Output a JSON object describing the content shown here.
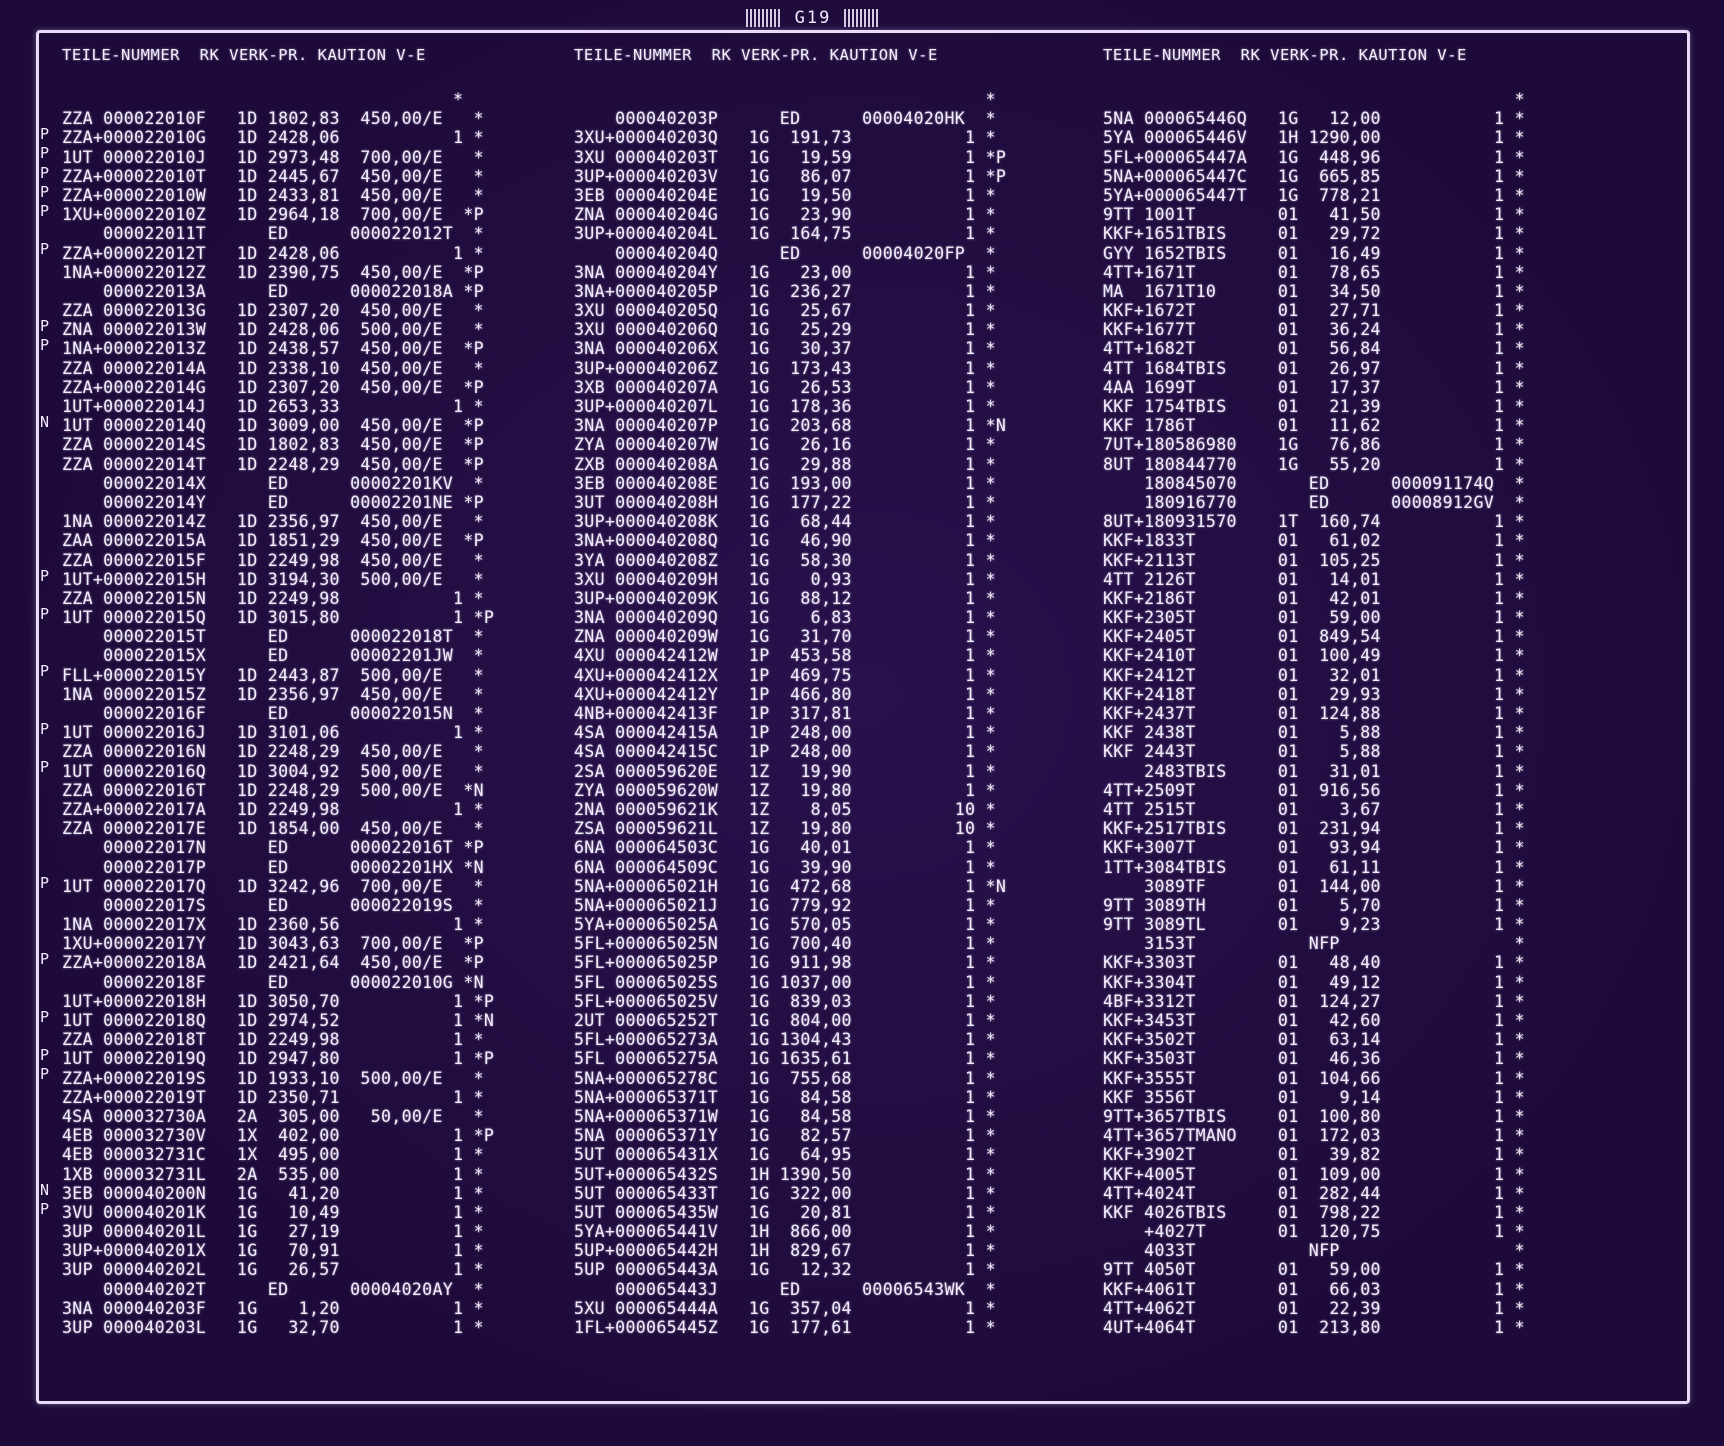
{
  "sheet": {
    "code": "G19"
  },
  "columns": {
    "header": "TEILE-NUMMER  RK VERK-PR. KAUTION V-E"
  },
  "panel1": [
    "                                      *",
    "ZZA 000022010F   1D 1802,83  450,00/E   *",
    "ZZA+000022010G   1D 2428,06           1 *",
    "1UT 000022010J   1D 2973,48  700,00/E   *",
    "ZZA+000022010T   1D 2445,67  450,00/E   *",
    "ZZA+000022010W   1D 2433,81  450,00/E   *",
    "1XU+000022010Z   1D 2964,18  700,00/E  *P",
    "    000022011T      ED      000022012T  *",
    "ZZA+000022012T   1D 2428,06           1 *",
    "1NA+000022012Z   1D 2390,75  450,00/E  *P",
    "    000022013A      ED      000022018A *P",
    "ZZA 000022013G   1D 2307,20  450,00/E   *",
    "ZNA 000022013W   1D 2428,06  500,00/E   *",
    "1NA+000022013Z   1D 2438,57  450,00/E  *P",
    "ZZA 000022014A   1D 2338,10  450,00/E   *",
    "ZZA+000022014G   1D 2307,20  450,00/E  *P",
    "1UT+000022014J   1D 2653,33           1 *",
    "1UT 000022014Q   1D 3009,00  450,00/E  *P",
    "ZZA 000022014S   1D 1802,83  450,00/E  *P",
    "ZZA 000022014T   1D 2248,29  450,00/E  *P",
    "    000022014X      ED      00002201KV  *",
    "    000022014Y      ED      00002201NE *P",
    "1NA 000022014Z   1D 2356,97  450,00/E   *",
    "ZAA 000022015A   1D 1851,29  450,00/E  *P",
    "ZZA 000022015F   1D 2249,98  450,00/E   *",
    "1UT+000022015H   1D 3194,30  500,00/E   *",
    "ZZA 000022015N   1D 2249,98           1 *",
    "1UT 000022015Q   1D 3015,80           1 *P",
    "    000022015T      ED      000022018T  *",
    "    000022015X      ED      00002201JW  *",
    "FLL+000022015Y   1D 2443,87  500,00/E   *",
    "1NA 000022015Z   1D 2356,97  450,00/E   *",
    "    000022016F      ED      000022015N  *",
    "1UT 000022016J   1D 3101,06           1 *",
    "ZZA 000022016N   1D 2248,29  450,00/E   *",
    "1UT 000022016Q   1D 3004,92  500,00/E   *",
    "ZZA 000022016T   1D 2248,29  500,00/E  *N",
    "ZZA+000022017A   1D 2249,98           1 *",
    "ZZA 000022017E   1D 1854,00  450,00/E   *",
    "    000022017N      ED      000022016T *P",
    "    000022017P      ED      00002201HX *N",
    "1UT 000022017Q   1D 3242,96  700,00/E   *",
    "    000022017S      ED      000022019S  *",
    "1NA 000022017X   1D 2360,56           1 *",
    "1XU+000022017Y   1D 3043,63  700,00/E  *P",
    "ZZA+000022018A   1D 2421,64  450,00/E  *P",
    "    000022018F      ED      000022010G *N",
    "1UT+000022018H   1D 3050,70           1 *P",
    "1UT 000022018Q   1D 2974,52           1 *N",
    "ZZA 000022018T   1D 2249,98           1 *",
    "1UT 000022019Q   1D 2947,80           1 *P",
    "ZZA+000022019S   1D 1933,10  500,00/E   *",
    "ZZA+000022019T   1D 2350,71           1 *",
    "4SA 000032730A   2A  305,00   50,00/E   *",
    "4EB 000032730V   1X  402,00           1 *P",
    "4EB 000032731C   1X  495,00           1 *",
    "1XB 000032731L   2A  535,00           1 *",
    "3EB 000040200N   1G   41,20           1 *",
    "3VU 000040201K   1G   10,49           1 *",
    "3UP 000040201L   1G   27,19           1 *",
    "3UP+000040201X   1G   70,91           1 *",
    "3UP 000040202L   1G   26,57           1 *",
    "    000040202T      ED      00004020AY  *",
    "3NA 000040203F   1G    1,20           1 *",
    "3UP 000040203L   1G   32,70           1 *"
  ],
  "panel2": [
    "                                        *",
    "    000040203P      ED      00004020HK  *",
    "3XU+000040203Q   1G  191,73           1 *",
    "3XU 000040203T   1G   19,59           1 *P",
    "3UP+000040203V   1G   86,07           1 *P",
    "3EB 000040204E   1G   19,50           1 *",
    "ZNA 000040204G   1G   23,90           1 *",
    "3UP+000040204L   1G  164,75           1 *",
    "    000040204Q      ED      00004020FP  *",
    "3NA 000040204Y   1G   23,00           1 *",
    "3NA+000040205P   1G  236,27           1 *",
    "3XU 000040205Q   1G   25,67           1 *",
    "3XU 000040206Q   1G   25,29           1 *",
    "3NA 000040206X   1G   30,37           1 *",
    "3UP+000040206Z   1G  173,43           1 *",
    "3XB 000040207A   1G   26,53           1 *",
    "3UP+000040207L   1G  178,36           1 *",
    "3NA 000040207P   1G  203,68           1 *N",
    "ZYA 000040207W   1G   26,16           1 *",
    "ZXB 000040208A   1G   29,88           1 *",
    "3EB 000040208E   1G  193,00           1 *",
    "3UT 000040208H   1G  177,22           1 *",
    "3UP+000040208K   1G   68,44           1 *",
    "3NA+000040208Q   1G   46,90           1 *",
    "3YA 000040208Z   1G   58,30           1 *",
    "3XU 000040209H   1G    0,93           1 *",
    "3UP+000040209K   1G   88,12           1 *",
    "3NA 000040209Q   1G    6,83           1 *",
    "ZNA 000040209W   1G   31,70           1 *",
    "4XU 000042412W   1P  453,58           1 *",
    "4XU+000042412X   1P  469,75           1 *",
    "4XU+000042412Y   1P  466,80           1 *",
    "4NB+000042413F   1P  317,81           1 *",
    "4SA 000042415A   1P  248,00           1 *",
    "4SA 000042415C   1P  248,00           1 *",
    "2SA 000059620E   1Z   19,90           1 *",
    "ZYA 000059620W   1Z   19,80           1 *",
    "2NA 000059621K   1Z    8,05          10 *",
    "ZSA 000059621L   1Z   19,80          10 *",
    "6NA 000064503C   1G   40,01           1 *",
    "6NA 000064509C   1G   39,90           1 *",
    "5NA+000065021H   1G  472,68           1 *N",
    "5NA+000065021J   1G  779,92           1 *",
    "5YA+000065025A   1G  570,05           1 *",
    "5FL+000065025N   1G  700,40           1 *",
    "5FL+000065025P   1G  911,98           1 *",
    "5FL 000065025S   1G 1037,00           1 *",
    "5FL+000065025V   1G  839,03           1 *",
    "2UT 000065252T   1G  804,00           1 *",
    "5FL+000065273A   1G 1304,43           1 *",
    "5FL 000065275A   1G 1635,61           1 *",
    "5NA+000065278C   1G  755,68           1 *",
    "5NA+000065371T   1G   84,58           1 *",
    "5NA+000065371W   1G   84,58           1 *",
    "5NA 000065371Y   1G   82,57           1 *",
    "5UT 000065431X   1G   64,95           1 *",
    "5UT+000065432S   1H 1390,50           1 *",
    "5UT 000065433T   1G  322,00           1 *",
    "5UT 000065435W   1G   20,81           1 *",
    "5YA+000065441V   1H  866,00           1 *",
    "5UP+000065442H   1H  829,67           1 *",
    "5UP 000065443A   1G   12,32           1 *",
    "    000065443J      ED      00006543WK  *",
    "5XU 000065444A   1G  357,04           1 *",
    "1FL+000065445Z   1G  177,61           1 *"
  ],
  "panel3": [
    "                                        *",
    "5NA 000065446Q   1G   12,00           1 *",
    "5YA 000065446V   1H 1290,00           1 *",
    "5FL+000065447A   1G  448,96           1 *",
    "5NA+000065447C   1G  665,85           1 *",
    "5YA+000065447T   1G  778,21           1 *",
    "9TT 1001T        01   41,50           1 *",
    "KKF+1651TBIS     01   29,72           1 *",
    "GYY 1652TBIS     01   16,49           1 *",
    "4TT+1671T        01   78,65           1 *",
    "MA  1671T10      01   34,50           1 *",
    "KKF+1672T        01   27,71           1 *",
    "KKF+1677T        01   36,24           1 *",
    "4TT+1682T        01   56,84           1 *",
    "4TT 1684TBIS     01   26,97           1 *",
    "4AA 1699T        01   17,37           1 *",
    "KKF 1754TBIS     01   21,39           1 *",
    "KKF 1786T        01   11,62           1 *",
    "7UT+180586980    1G   76,86           1 *",
    "8UT 180844770    1G   55,20           1 *",
    "    180845070       ED      000091174Q  *",
    "    180916770       ED      00008912GV  *",
    "8UT+180931570    1T  160,74           1 *",
    "KKF+1833T        01   61,02           1 *",
    "KKF+2113T        01  105,25           1 *",
    "4TT 2126T        01   14,01           1 *",
    "KKF+2186T        01   42,01           1 *",
    "KKF+2305T        01   59,00           1 *",
    "KKF+2405T        01  849,54           1 *",
    "KKF+2410T        01  100,49           1 *",
    "KKF+2412T        01   32,01           1 *",
    "KKF+2418T        01   29,93           1 *",
    "KKF+2437T        01  124,88           1 *",
    "KKF 2438T        01    5,88           1 *",
    "KKF 2443T        01    5,88           1 *",
    "    2483TBIS     01   31,01           1 *",
    "4TT+2509T        01  916,56           1 *",
    "4TT 2515T        01    3,67           1 *",
    "KKF+2517TBIS     01  231,94           1 *",
    "KKF+3007T        01   93,94           1 *",
    "1TT+3084TBIS     01   61,11           1 *",
    "    3089TF       01  144,00           1 *",
    "9TT 3089TH       01    5,70           1 *",
    "9TT 3089TL       01    9,23           1 *",
    "    3153T           NFP                 *",
    "KKF+3303T        01   48,40           1 *",
    "KKF+3304T        01   49,12           1 *",
    "4BF+3312T        01  124,27           1 *",
    "KKF+3453T        01   42,60           1 *",
    "KKF+3502T        01   63,14           1 *",
    "KKF+3503T        01   46,36           1 *",
    "KKF+3555T        01  104,66           1 *",
    "KKF 3556T        01    9,14           1 *",
    "9TT+3657TBIS     01  100,80           1 *",
    "4TT+3657TMANO    01  172,03           1 *",
    "KKF+3902T        01   39,82           1 *",
    "KKF+4005T        01  109,00           1 *",
    "4TT+4024T        01  282,44           1 *",
    "KKF 4026TBIS     01  798,22           1 *",
    "    +4027T       01  120,75           1 *",
    "    4033T           NFP                 *",
    "9TT 4050T        01   59,00           1 *",
    "KKF+4061T        01   66,03           1 *",
    "4TT+4062T        01   22,39           1 *",
    "4UT+4064T        01  213,80           1 *"
  ],
  "margin_marks": [
    "",
    "P",
    "P",
    "P",
    "P",
    "P",
    "",
    "P",
    "",
    "",
    "",
    "P",
    "P",
    "",
    "",
    "",
    "N",
    "",
    "",
    "",
    "",
    "",
    "",
    "",
    "P",
    "",
    "P",
    "",
    "",
    "P",
    "",
    "",
    "P",
    "",
    "P",
    "",
    "",
    "",
    "",
    "",
    "P",
    "",
    "",
    "",
    "P",
    "",
    "",
    "P",
    "",
    "P",
    "P",
    "",
    "",
    "",
    "",
    "",
    "N",
    "P",
    "",
    "",
    "",
    "",
    "",
    ""
  ]
}
